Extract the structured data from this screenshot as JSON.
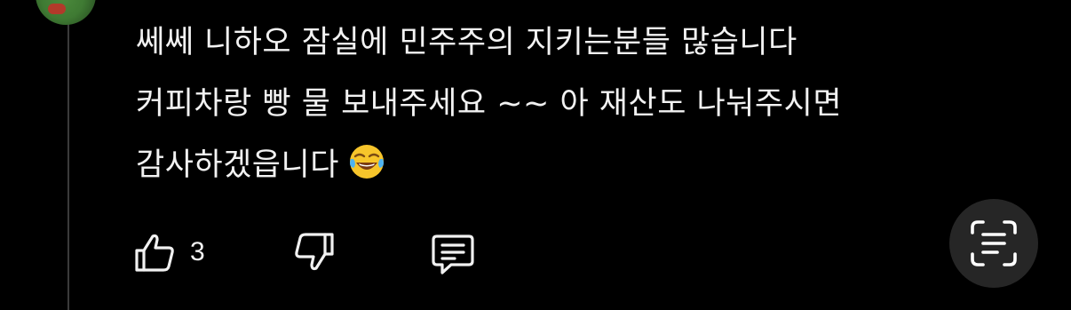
{
  "comment": {
    "lines": [
      "쎄쎄 니하오 잠실에 민주주의 지키는분들 많습니다",
      "커피차랑 빵 물 보내주세요 ~~ 아 재산도 나눠주시면",
      "감사하겠읍니다"
    ],
    "emoji": "face-with-tears-of-joy"
  },
  "actions": {
    "like_count": "3",
    "like_icon": "thumbs-up-icon",
    "dislike_icon": "thumbs-down-icon",
    "reply_icon": "comment-icon"
  },
  "floating": {
    "lens_icon": "scan-text-icon"
  },
  "colors": {
    "background": "#000000",
    "text": "#f2f2f2",
    "button_bg": "#262626"
  }
}
